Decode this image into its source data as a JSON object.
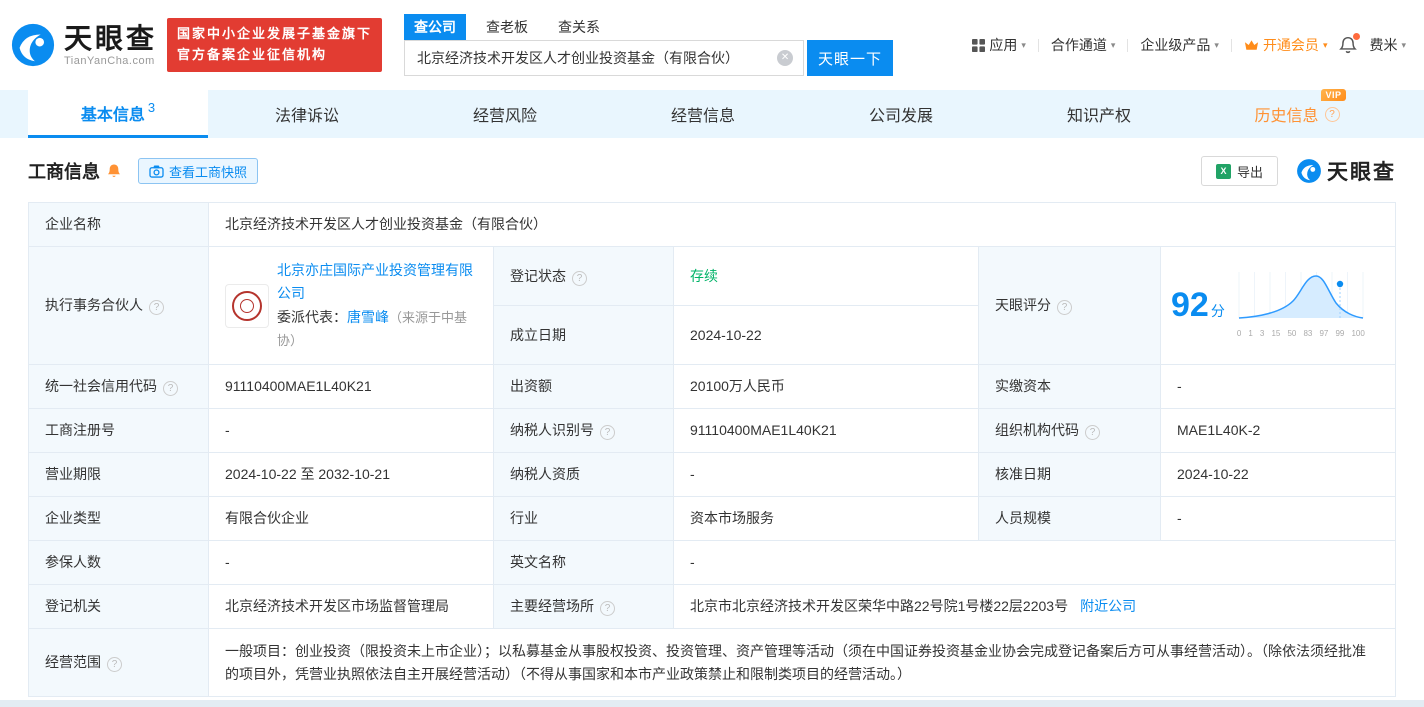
{
  "brand": {
    "name": "天眼查",
    "domain": "TianYanCha.com",
    "badge_line1": "国家中小企业发展子基金旗下",
    "badge_line2": "官方备案企业征信机构"
  },
  "search": {
    "tabs": [
      {
        "label": "查公司"
      },
      {
        "label": "查老板"
      },
      {
        "label": "查关系"
      }
    ],
    "value": "北京经济技术开发区人才创业投资基金（有限合伙）",
    "button": "天眼一下"
  },
  "topnav": {
    "apps": "应用",
    "partner": "合作通道",
    "enterprise": "企业级产品",
    "vip": "开通会员",
    "user": "费米"
  },
  "tabs": {
    "basic": "基本信息",
    "basic_count": "3",
    "lawsuit": "法律诉讼",
    "risk": "经营风险",
    "business": "经营信息",
    "development": "公司发展",
    "ip": "知识产权",
    "history": "历史信息",
    "vip_tag": "VIP"
  },
  "section": {
    "title": "工商信息",
    "snapshot": "查看工商快照",
    "export": "导出",
    "watermark": "天眼查"
  },
  "icons": {
    "chevron_down": "▾",
    "clear": "✕",
    "question": "?",
    "excel": "X"
  },
  "score_chart": {
    "type": "area",
    "score": 92,
    "axis": [
      "0",
      "1",
      "3",
      "15",
      "50",
      "83",
      "97",
      "99",
      "100"
    ]
  },
  "info": {
    "company_name": {
      "label": "企业名称",
      "value": "北京经济技术开发区人才创业投资基金（有限合伙）"
    },
    "partner": {
      "label": "执行事务合伙人",
      "company": "北京亦庄国际产业投资管理有限公司",
      "rep_prefix": "委派代表：",
      "rep_name": "唐雪峰",
      "rep_source": "（来源于中基协）"
    },
    "reg_status": {
      "label": "登记状态",
      "value": "存续"
    },
    "establish_date": {
      "label": "成立日期",
      "value": "2024-10-22"
    },
    "tyc_score": {
      "label": "天眼评分",
      "value": "92",
      "unit": "分"
    },
    "credit_code": {
      "label": "统一社会信用代码",
      "value": "91110400MAE1L40K21"
    },
    "capital": {
      "label": "出资额",
      "value": "20100万人民币"
    },
    "paid_capital": {
      "label": "实缴资本",
      "value": "-"
    },
    "reg_number": {
      "label": "工商注册号",
      "value": "-"
    },
    "taxpayer_id": {
      "label": "纳税人识别号",
      "value": "91110400MAE1L40K21"
    },
    "org_code": {
      "label": "组织机构代码",
      "value": "MAE1L40K-2"
    },
    "business_term": {
      "label": "营业期限",
      "value": "2024-10-22 至 2032-10-21"
    },
    "taxpayer_quality": {
      "label": "纳税人资质",
      "value": "-"
    },
    "approval_date": {
      "label": "核准日期",
      "value": "2024-10-22"
    },
    "company_type": {
      "label": "企业类型",
      "value": "有限合伙企业"
    },
    "industry": {
      "label": "行业",
      "value": "资本市场服务"
    },
    "staff_size": {
      "label": "人员规模",
      "value": "-"
    },
    "insured_count": {
      "label": "参保人数",
      "value": "-"
    },
    "english_name": {
      "label": "英文名称",
      "value": "-"
    },
    "registry": {
      "label": "登记机关",
      "value": "北京经济技术开发区市场监督管理局"
    },
    "address": {
      "label": "主要经营场所",
      "value": "北京市北京经济技术开发区荣华中路22号院1号楼22层2203号",
      "nearby": "附近公司"
    },
    "scope": {
      "label": "经营范围",
      "value": "一般项目：创业投资（限投资未上市企业）；以私募基金从事股权投资、投资管理、资产管理等活动（须在中国证券投资基金业协会完成登记备案后方可从事经营活动）。（除依法须经批准的项目外，凭营业执照依法自主开展经营活动）（不得从事国家和本市产业政策禁止和限制类项目的经营活动。）"
    }
  }
}
